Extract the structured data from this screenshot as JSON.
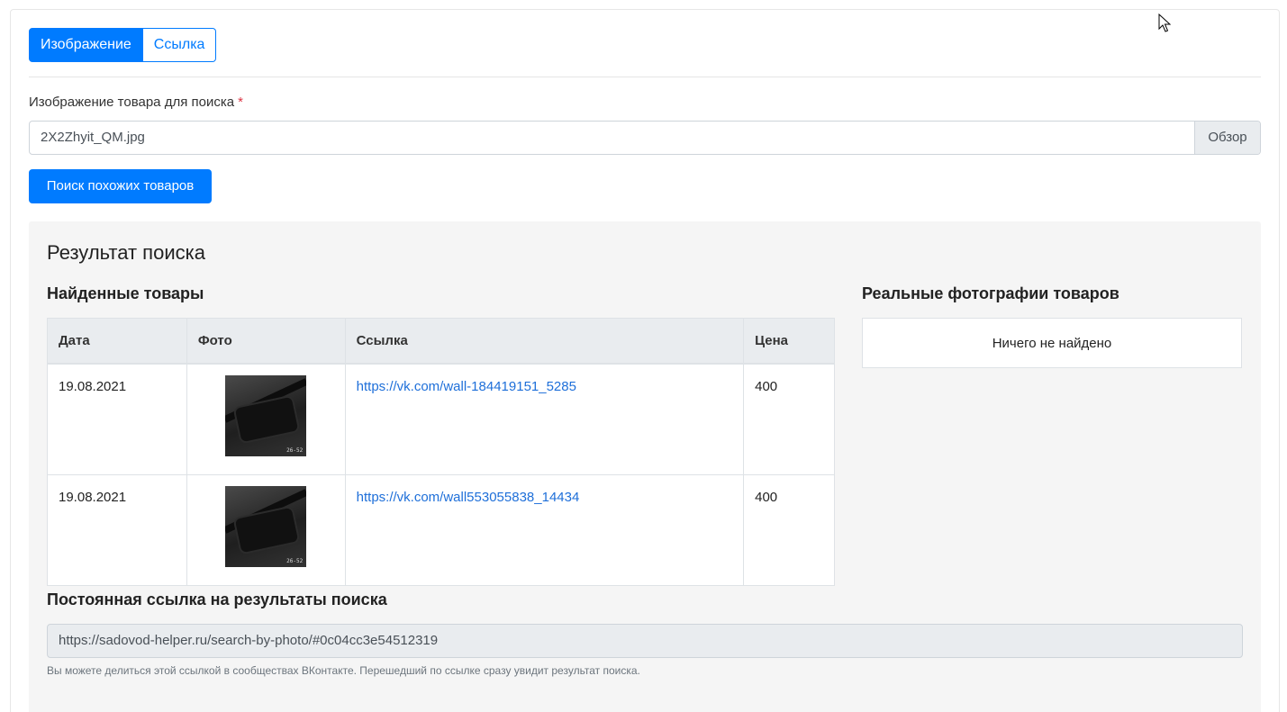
{
  "tabs": [
    {
      "label": "Изображение",
      "active": true
    },
    {
      "label": "Ссылка",
      "active": false
    }
  ],
  "upload": {
    "label": "Изображение товара для поиска",
    "required_mark": "*",
    "file_name": "2X2Zhyit_QM.jpg",
    "browse_label": "Обзор"
  },
  "search_button": "Поиск похожих товаров",
  "results": {
    "title": "Результат поиска",
    "found_title": "Найденные товары",
    "columns": [
      "Дата",
      "Фото",
      "Ссылка",
      "Цена"
    ],
    "rows": [
      {
        "date": "19.08.2021",
        "photo_tag": "26-52",
        "link": "https://vk.com/wall-184419151_5285",
        "price": "400"
      },
      {
        "date": "19.08.2021",
        "photo_tag": "26-52",
        "link": "https://vk.com/wall553055838_14434",
        "price": "400"
      }
    ],
    "real_title": "Реальные фотографии товаров",
    "real_empty": "Ничего не найдено"
  },
  "permalink": {
    "title": "Постоянная ссылка на результаты поиска",
    "value": "https://sadovod-helper.ru/search-by-photo/#0c04cc3e54512319",
    "hint": "Вы можете делиться этой ссылкой в сообществах ВКонтакте. Перешедший по ссылке сразу увидит результат поиска."
  },
  "colors": {
    "primary": "#007bff",
    "link": "#1e6fd9",
    "required": "#dc3545"
  }
}
